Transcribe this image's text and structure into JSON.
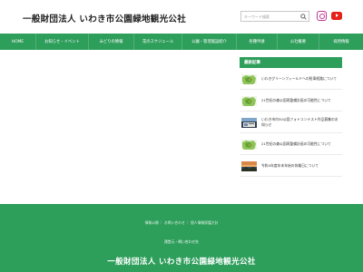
{
  "header": {
    "site_title": "一般財団法人 いわき市公園緑地観光公社",
    "search_placeholder": "キーワード検索"
  },
  "nav": {
    "items": [
      "HOME",
      "お知らせ・イベント",
      "みどりの情報",
      "花のスケジュール",
      "公園・管理施設紹介",
      "各種申請",
      "公社概要",
      "採用情報"
    ]
  },
  "sidebar": {
    "heading": "最新記事",
    "posts": [
      {
        "title": "いわきグリーンフィールドへの駐車経路について",
        "thumb": "map-thumb"
      },
      {
        "title": "21世紀の森公園再整備計画の可能性について",
        "thumb": "map-thumb"
      },
      {
        "title": "いわき市内50公園フォトコンテスト作品募集のお知らせ",
        "thumb": "photo-thumb"
      },
      {
        "title": "21世紀の森公園再整備計画の可能性について",
        "thumb": "map-thumb"
      },
      {
        "title": "令和4年度年末年始の休業日について",
        "thumb": "landscape-thumb"
      }
    ]
  },
  "footer": {
    "links": "情報公開 ｜ お問い合わせ ｜ 個人情報保護方針",
    "subtitle": "運営元・問い合わせ先",
    "org_name": "一般財団法人 いわき市公園緑地観光公社"
  },
  "colors": {
    "brand_green": "#2e9e5b",
    "instagram": "#c1358f",
    "youtube": "#e62117"
  },
  "icons": {
    "search": "search-icon",
    "instagram": "instagram-icon",
    "youtube": "youtube-icon"
  }
}
